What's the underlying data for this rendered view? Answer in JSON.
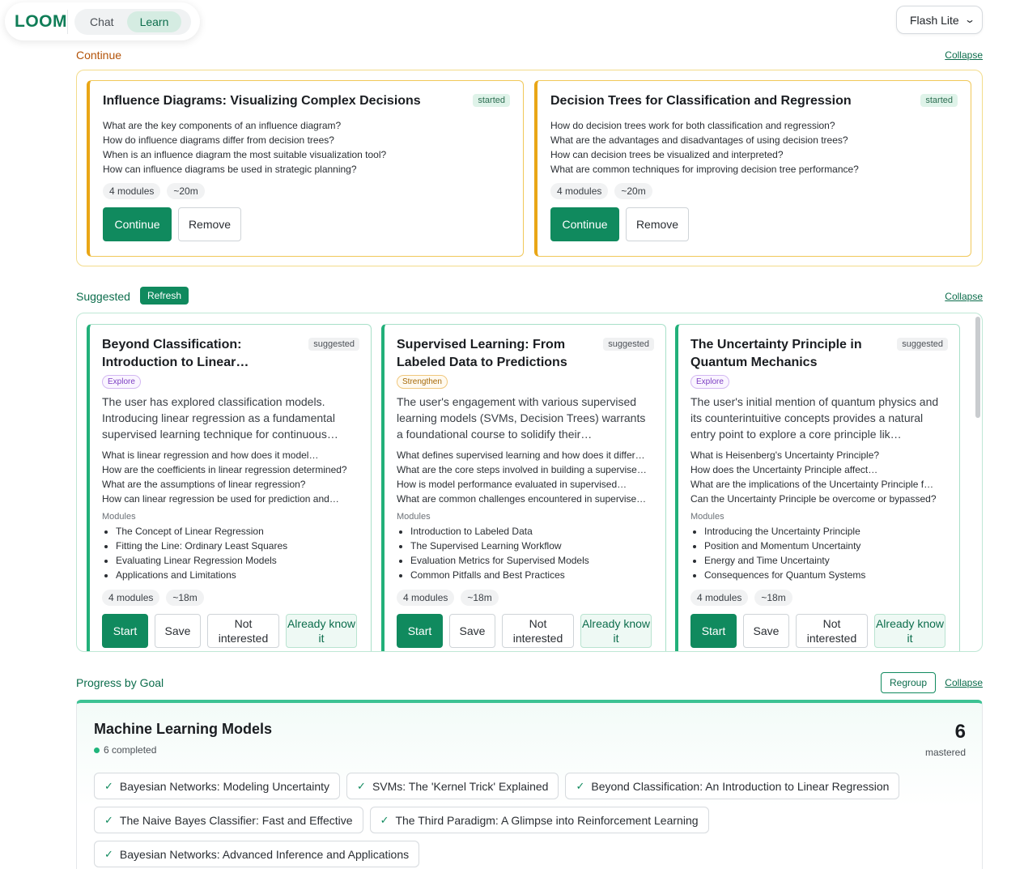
{
  "app": {
    "logo": "LOOM",
    "tabs": [
      "Chat",
      "Learn"
    ],
    "model_select": "Flash Lite"
  },
  "continue": {
    "title": "Continue",
    "collapse": "Collapse",
    "cards": [
      {
        "title": "Influence Diagrams: Visualizing Complex Decisions",
        "status": "started",
        "questions": [
          "What are the key components of an influence diagram?",
          "How do influence diagrams differ from decision trees?",
          "When is an influence diagram the most suitable visualization tool?",
          "How can influence diagrams be used in strategic planning?"
        ],
        "modules": "4 modules",
        "duration": "~20m",
        "continue_label": "Continue",
        "remove_label": "Remove"
      },
      {
        "title": "Decision Trees for Classification and Regression",
        "status": "started",
        "questions": [
          "How do decision trees work for both classification and regression?",
          "What are the advantages and disadvantages of using decision trees?",
          "How can decision trees be visualized and interpreted?",
          "What are common techniques for improving decision tree performance?"
        ],
        "modules": "4 modules",
        "duration": "~20m",
        "continue_label": "Continue",
        "remove_label": "Remove"
      }
    ]
  },
  "suggested": {
    "title": "Suggested",
    "refresh": "Refresh",
    "collapse": "Collapse",
    "modules_label": "Modules",
    "cards": [
      {
        "title": "Beyond Classification: Introduction to Linear…",
        "status": "suggested",
        "purpose": "Explore",
        "description": "The user has explored classification models. Introducing linear regression as a fundamental supervised learning technique for continuous…",
        "questions": [
          "What is linear regression and how does it model…",
          "How are the coefficients in linear regression determined?",
          "What are the assumptions of linear regression?",
          "How can linear regression be used for prediction and…"
        ],
        "modules_list": [
          "The Concept of Linear Regression",
          "Fitting the Line: Ordinary Least Squares",
          "Evaluating Linear Regression Models",
          "Applications and Limitations"
        ],
        "modules": "4 modules",
        "duration": "~18m"
      },
      {
        "title": "Supervised Learning: From Labeled Data to Predictions",
        "status": "suggested",
        "purpose": "Strengthen",
        "description": "The user's engagement with various supervised learning models (SVMs, Decision Trees) warrants a foundational course to solidify their…",
        "questions": [
          "What defines supervised learning and how does it differ…",
          "What are the core steps involved in building a supervise…",
          "How is model performance evaluated in supervised…",
          "What are common challenges encountered in supervise…"
        ],
        "modules_list": [
          "Introduction to Labeled Data",
          "The Supervised Learning Workflow",
          "Evaluation Metrics for Supervised Models",
          "Common Pitfalls and Best Practices"
        ],
        "modules": "4 modules",
        "duration": "~18m"
      },
      {
        "title": "The Uncertainty Principle in Quantum Mechanics",
        "status": "suggested",
        "purpose": "Explore",
        "description": "The user's initial mention of quantum physics and its counterintuitive concepts provides a natural entry point to explore a core principle lik…",
        "questions": [
          "What is Heisenberg's Uncertainty Principle?",
          "How does the Uncertainty Principle affect…",
          "What are the implications of the Uncertainty Principle f…",
          "Can the Uncertainty Principle be overcome or bypassed?"
        ],
        "modules_list": [
          "Introducing the Uncertainty Principle",
          "Position and Momentum Uncertainty",
          "Energy and Time Uncertainty",
          "Consequences for Quantum Systems"
        ],
        "modules": "4 modules",
        "duration": "~18m"
      }
    ],
    "actions": {
      "start": "Start",
      "save": "Save",
      "not_interested": "Not interested",
      "already_know": "Already know it"
    }
  },
  "progress": {
    "title": "Progress by Goal",
    "regroup": "Regroup",
    "collapse": "Collapse",
    "goal": {
      "name": "Machine Learning Models",
      "completed": "6 completed",
      "mastered_count": "6",
      "mastered_label": "mastered",
      "items": [
        "Bayesian Networks: Modeling Uncertainty",
        "SVMs: The 'Kernel Trick' Explained",
        "Beyond Classification: An Introduction to Linear Regression",
        "The Naive Bayes Classifier: Fast and Effective",
        "The Third Paradigm: A Glimpse into Reinforcement Learning",
        "Bayesian Networks: Advanced Inference and Applications"
      ]
    }
  },
  "colors": {
    "brand": "#108a5e",
    "started_accent": "#e9a616",
    "suggested_accent": "#22b07a"
  }
}
